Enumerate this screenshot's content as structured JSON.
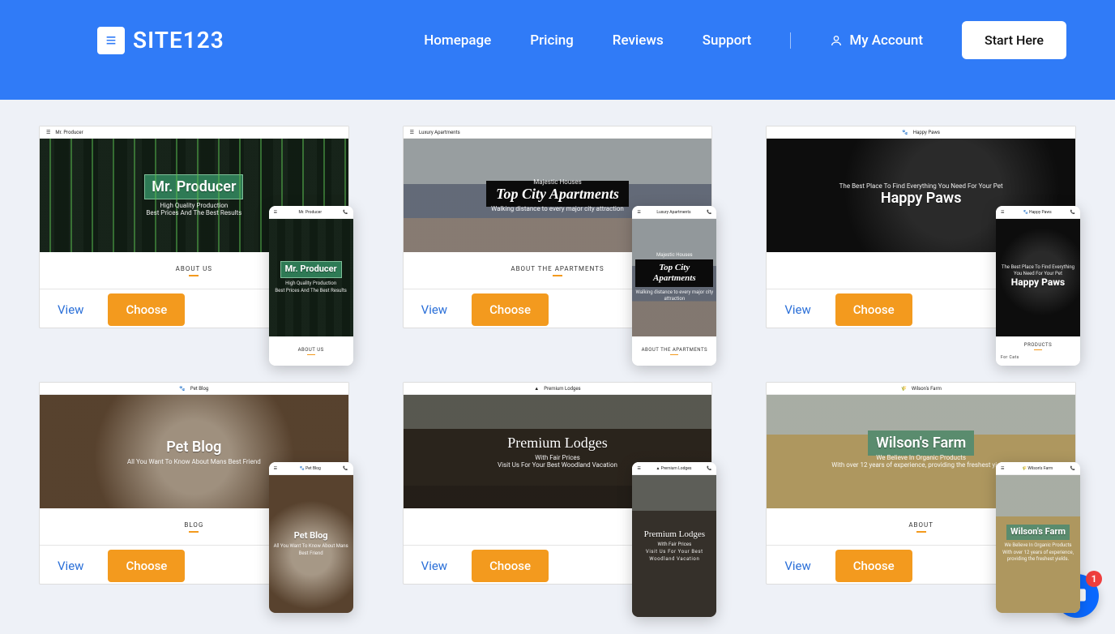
{
  "header": {
    "logo_text": "SITE123",
    "nav": [
      "Homepage",
      "Pricing",
      "Reviews",
      "Support"
    ],
    "account": "My Account",
    "start": "Start Here"
  },
  "actions": {
    "view": "View",
    "choose": "Choose"
  },
  "templates": [
    {
      "name": "Mr. Producer",
      "title": "Mr. Producer",
      "subtitle": "High Quality Production",
      "tagline": "Best Prices And The Best Results",
      "about": "ABOUT US",
      "mobile_about": "ABOUT US"
    },
    {
      "name": "Luxury Apartments",
      "pretitle": "Majestic Houses",
      "title": "Top City Apartments",
      "tagline": "Walking distance to every major city attraction",
      "about": "ABOUT THE APARTMENTS",
      "mobile_about": "ABOUT THE APARTMENTS"
    },
    {
      "name": "Happy Paws",
      "tagline": "The Best Place To Find Everything You Need For Your Pet",
      "title": "Happy Paws",
      "mobile_pretitle": "The Best Place To Find Everything You Need For Your Pet",
      "mobile_about": "PRODUCTS",
      "mobile_about_sub": "For Cats"
    },
    {
      "name": "Pet Blog",
      "title": "Pet Blog",
      "tagline": "All You Want To Know About Mans Best Friend",
      "about": "BLOG",
      "mobile_about": ""
    },
    {
      "name": "Premium Lodges",
      "title": "Premium Lodges",
      "subtitle": "With Fair Prices",
      "tagline": "Visit Us For Your Best Woodland Vacation",
      "mobile_about": ""
    },
    {
      "name": "Wilson's Farm",
      "title": "Wilson's Farm",
      "subtitle": "We Believe In Organic Products",
      "tagline": "With over 12 years of experience, providing the freshest yields.",
      "about": "ABOUT",
      "mobile_about": ""
    }
  ],
  "chat": {
    "unread": "1"
  }
}
